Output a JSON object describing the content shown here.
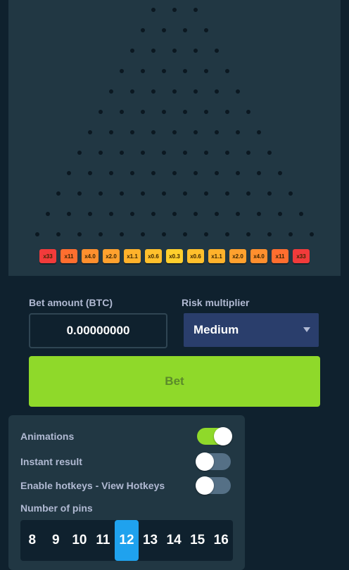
{
  "board": {
    "rows": 12,
    "multipliers": [
      {
        "label": "x33",
        "color": "#f23b3b"
      },
      {
        "label": "x11",
        "color": "#ff6e2f"
      },
      {
        "label": "x4.0",
        "color": "#ff8f2e"
      },
      {
        "label": "x2.0",
        "color": "#ffa12e"
      },
      {
        "label": "x1.1",
        "color": "#ffb22b"
      },
      {
        "label": "x0.6",
        "color": "#ffc02c"
      },
      {
        "label": "x0.3",
        "color": "#ffcf2d"
      },
      {
        "label": "x0.6",
        "color": "#ffc02c"
      },
      {
        "label": "x1.1",
        "color": "#ffb22b"
      },
      {
        "label": "x2.0",
        "color": "#ffa12e"
      },
      {
        "label": "x4.0",
        "color": "#ff8f2e"
      },
      {
        "label": "x11",
        "color": "#ff6e2f"
      },
      {
        "label": "x33",
        "color": "#f23b3b"
      }
    ]
  },
  "controls": {
    "bet_amount_label": "Bet amount (BTC)",
    "bet_amount_value": "0.00000000",
    "risk_label": "Risk multiplier",
    "risk_value": "Medium",
    "bet_button_label": "Bet"
  },
  "settings": {
    "animations_label": "Animations",
    "animations_on": true,
    "instant_label": "Instant result",
    "instant_on": false,
    "hotkeys_label": "Enable hotkeys - View Hotkeys",
    "hotkeys_on": false,
    "pins_label": "Number of pins",
    "pin_options": [
      "8",
      "9",
      "10",
      "11",
      "12",
      "13",
      "14",
      "15",
      "16"
    ],
    "selected_pins": "12"
  },
  "colors": {
    "accent_green": "#8fd92a",
    "selected_blue": "#1fa2ee",
    "panel": "#213743",
    "background": "#0f212e"
  }
}
